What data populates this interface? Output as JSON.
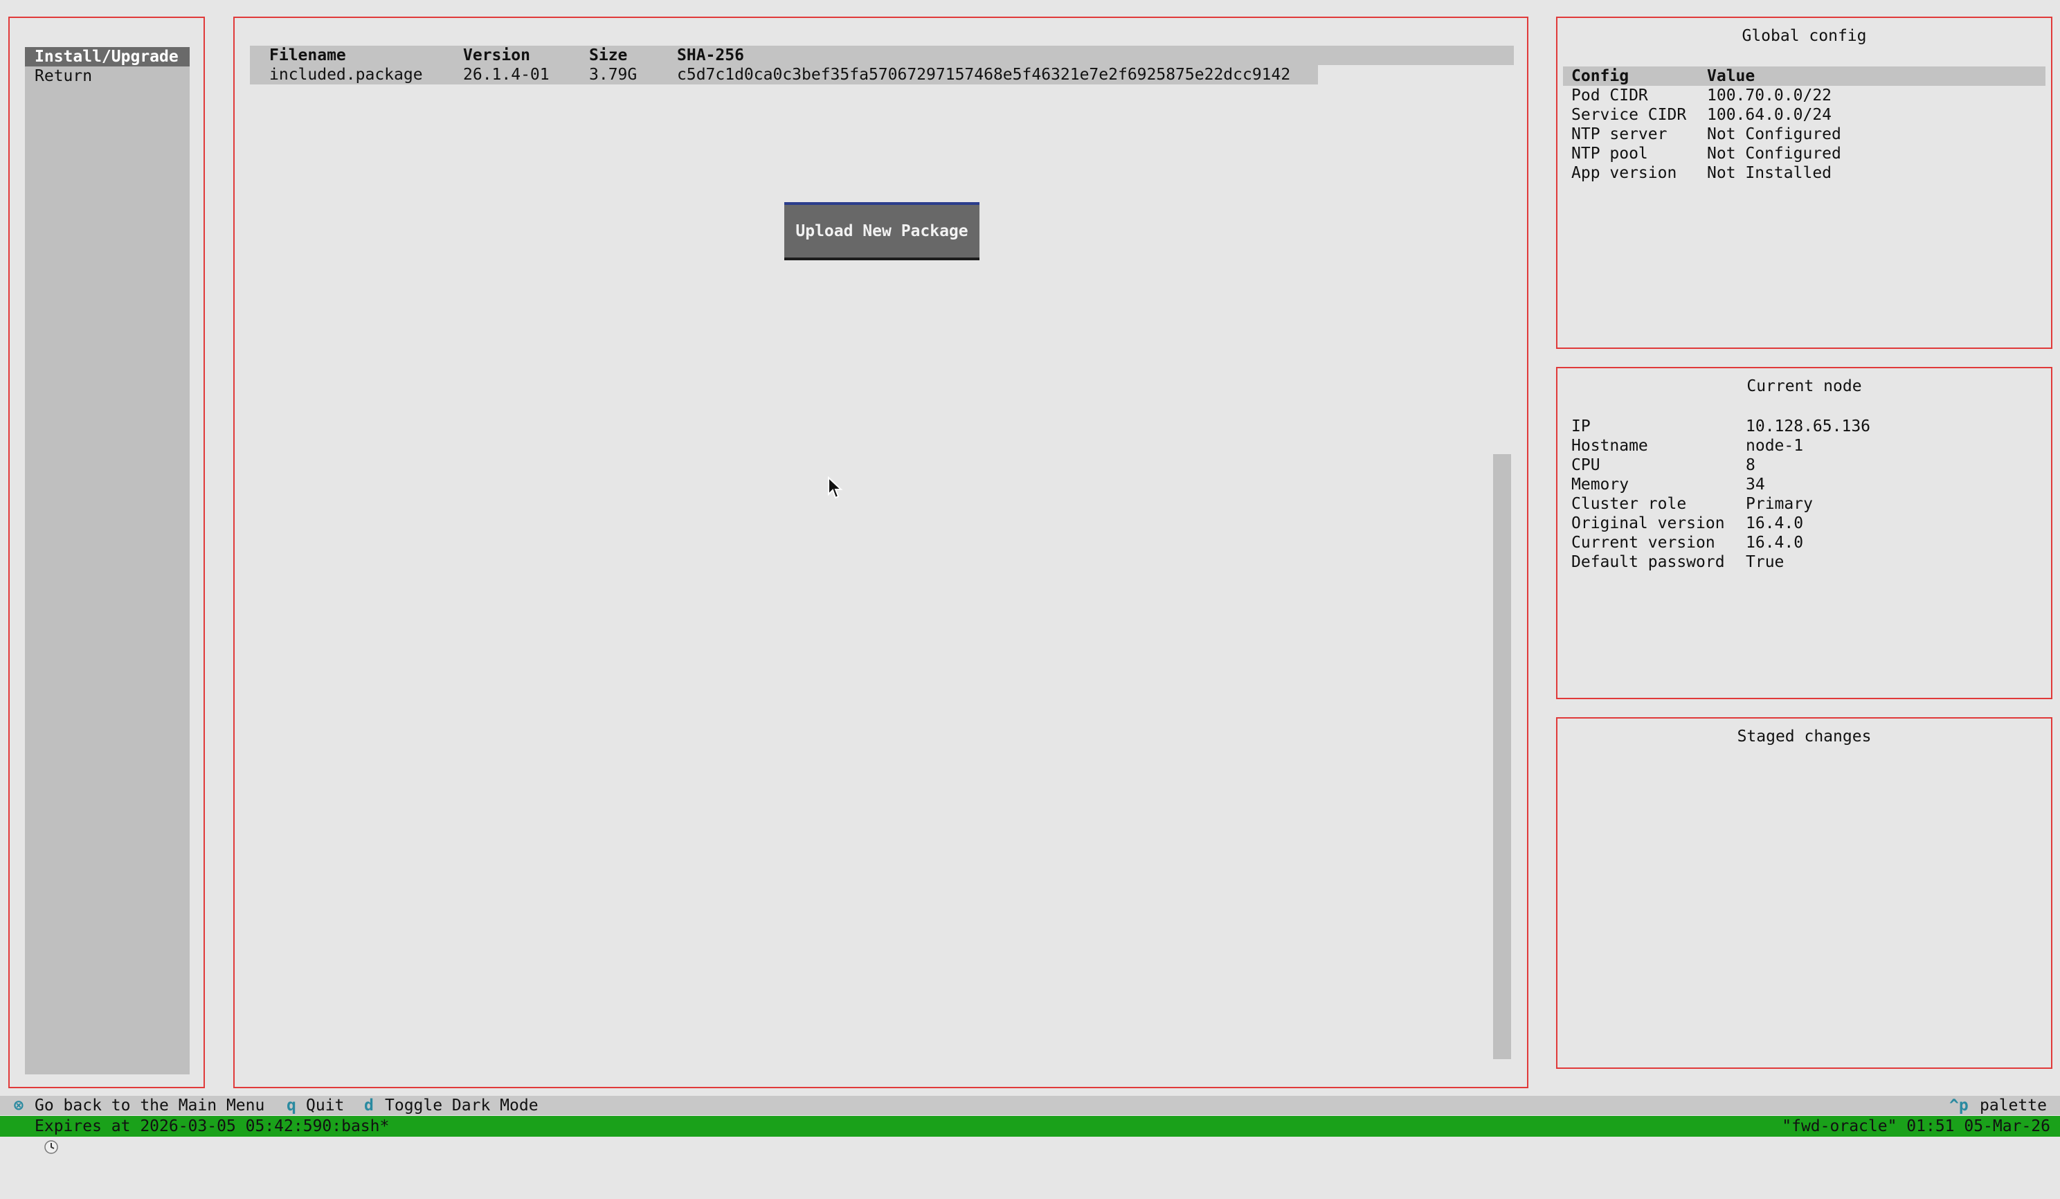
{
  "sidebar": {
    "items": [
      {
        "label": "Install/Upgrade",
        "active": true
      },
      {
        "label": "Return",
        "active": false
      }
    ]
  },
  "packages": {
    "columns": [
      "Filename",
      "Version",
      "Size",
      "SHA-256"
    ],
    "rows": [
      [
        "included.package",
        "26.1.4-01",
        "3.79G",
        "c5d7c1d0ca0c3bef35fa57067297157468e5f46321e7e2f6925875e22dcc9142"
      ]
    ],
    "upload_button": "Upload New Package"
  },
  "global_config": {
    "title": "Global config",
    "columns": [
      "Config",
      "Value"
    ],
    "rows": [
      [
        "Pod CIDR",
        "100.70.0.0/22"
      ],
      [
        "Service CIDR",
        "100.64.0.0/24"
      ],
      [
        "NTP server",
        "Not Configured"
      ],
      [
        "NTP pool",
        "Not Configured"
      ],
      [
        "App version",
        "Not Installed"
      ]
    ]
  },
  "current_node": {
    "title": "Current node",
    "rows": [
      [
        "IP",
        "10.128.65.136"
      ],
      [
        "Hostname",
        "node-1"
      ],
      [
        "CPU",
        "8"
      ],
      [
        "Memory",
        "34"
      ],
      [
        "Cluster role",
        "Primary"
      ],
      [
        "Original version",
        "16.4.0"
      ],
      [
        "Current version",
        "16.4.0"
      ],
      [
        "Default password",
        "True"
      ]
    ]
  },
  "staged_changes": {
    "title": "Staged changes"
  },
  "footer": {
    "back_key": "⊗",
    "back_label": "Go back to the Main Menu",
    "quit_key": "q",
    "quit_label": "Quit",
    "dark_key": "d",
    "dark_label": "Toggle Dark Mode",
    "palette_key": "^p",
    "palette_label": "palette"
  },
  "tmux": {
    "clock_icon": "clock-icon",
    "left": "Expires at 2026-03-05 05:42:590:bash*",
    "right": "\"fwd-oracle\" 01:51 05-Mar-26"
  }
}
